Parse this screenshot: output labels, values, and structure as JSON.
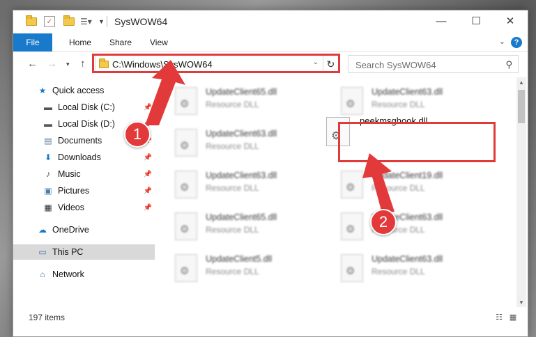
{
  "window": {
    "title": "SysWOW64",
    "controls": {
      "minimize": "—",
      "maximize": "☐",
      "close": "✕"
    }
  },
  "ribbon": {
    "tabs": [
      "File",
      "Home",
      "Share",
      "View"
    ],
    "help": "?"
  },
  "address_bar": {
    "path": "C:\\Windows\\SysWOW64"
  },
  "search": {
    "placeholder": "Search SysWOW64"
  },
  "sidebar": {
    "items": [
      {
        "label": "Quick access",
        "icon": "star-icon",
        "pinned": false
      },
      {
        "label": "Local Disk (C:)",
        "icon": "drive-icon",
        "pinned": true
      },
      {
        "label": "Local Disk (D:)",
        "icon": "drive-icon",
        "pinned": true
      },
      {
        "label": "Documents",
        "icon": "documents-icon",
        "pinned": true
      },
      {
        "label": "Downloads",
        "icon": "downloads-icon",
        "pinned": true
      },
      {
        "label": "Music",
        "icon": "music-icon",
        "pinned": true
      },
      {
        "label": "Pictures",
        "icon": "pictures-icon",
        "pinned": true
      },
      {
        "label": "Videos",
        "icon": "videos-icon",
        "pinned": true
      },
      {
        "label": "OneDrive",
        "icon": "onedrive-icon",
        "pinned": false
      },
      {
        "label": "This PC",
        "icon": "pc-icon",
        "pinned": false,
        "selected": true
      },
      {
        "label": "Network",
        "icon": "network-icon",
        "pinned": false
      }
    ]
  },
  "files": [
    {
      "name": "UpdateClient65.dll",
      "type": "Resource DLL"
    },
    {
      "name": "UpdateClient63.dll",
      "type": "Resource DLL"
    },
    {
      "name": "UpdateClient63.dll",
      "type": "Resource DLL"
    },
    {
      "name": "UpdateClient63.dll",
      "type": "Resource DLL"
    },
    {
      "name": "UpdateClient19.dll",
      "type": "Resource DLL"
    },
    {
      "name": "UpdateClient65.dll",
      "type": "Resource DLL"
    },
    {
      "name": "UpdateClient63.dll",
      "type": "Resource DLL"
    },
    {
      "name": "UpdateClient5.dll",
      "type": "Resource DLL"
    },
    {
      "name": "UpdateClient63.dll",
      "type": "Resource DLL"
    }
  ],
  "highlighted_file": {
    "name": "peekmsghook.dll"
  },
  "status_bar": {
    "item_count": "197 items"
  },
  "annotations": {
    "step1": "1",
    "step2": "2",
    "color": "#e23a3a"
  }
}
